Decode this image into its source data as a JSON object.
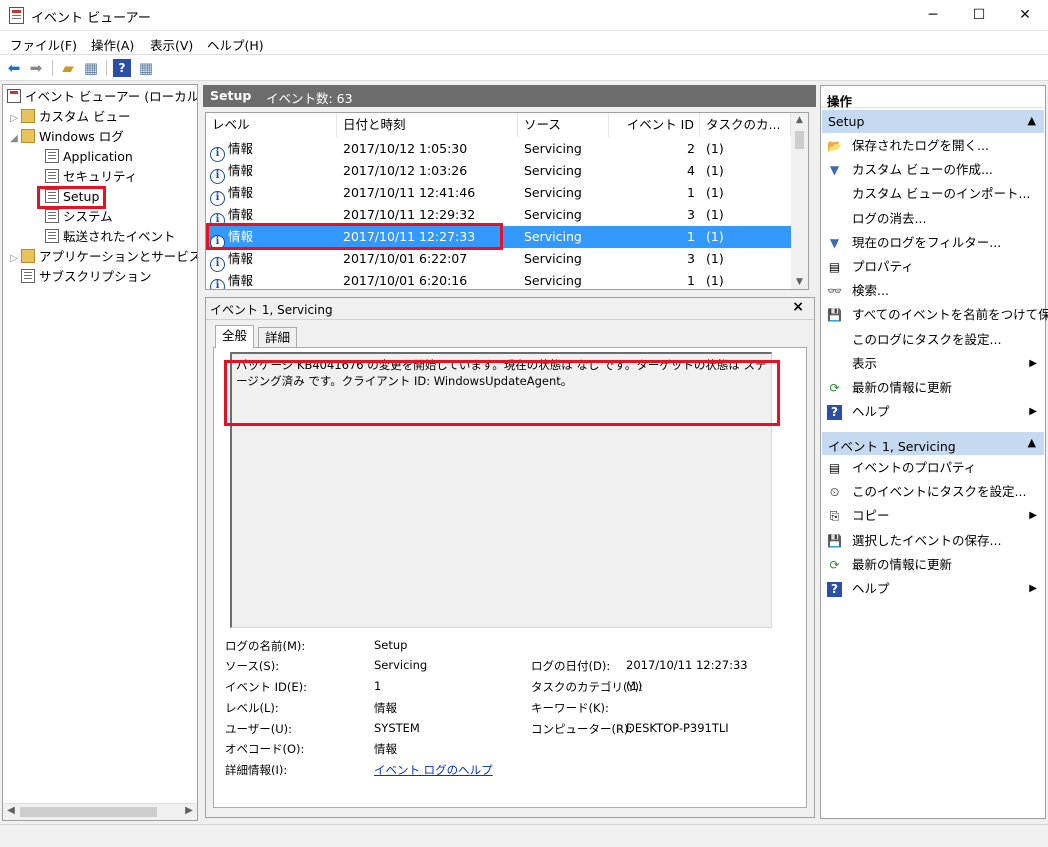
{
  "window": {
    "title": "イベント ビューアー",
    "minimize": "─",
    "maximize": "☐",
    "close": "✕"
  },
  "menu": [
    "ファイル(F)",
    "操作(A)",
    "表示(V)",
    "ヘルプ(H)"
  ],
  "toolbar": {
    "icons": [
      "back-arrow-icon",
      "forward-arrow-icon",
      "folder-up-icon",
      "show-hide-tree-icon",
      "help-icon",
      "show-hide-action-pane-icon"
    ]
  },
  "tree": {
    "root": "イベント ビューアー (ローカル)",
    "custom_views": "カスタム ビュー",
    "windows_logs": "Windows ログ",
    "application": "Application",
    "security": "セキュリティ",
    "setup": "Setup",
    "system": "システム",
    "forwarded": "転送されたイベント",
    "apps_services": "アプリケーションとサービス ログ",
    "subscriptions": "サブスクリプション"
  },
  "center": {
    "log_name": "Setup",
    "event_count": "イベント数: 63"
  },
  "list": {
    "columns": [
      "レベル",
      "日付と時刻",
      "ソース",
      "イベント ID",
      "タスクのカ..."
    ],
    "rows": [
      {
        "level": "情報",
        "datetime": "2017/10/12 1:05:30",
        "source": "Servicing",
        "id": "2",
        "task": "(1)"
      },
      {
        "level": "情報",
        "datetime": "2017/10/12 1:03:26",
        "source": "Servicing",
        "id": "4",
        "task": "(1)"
      },
      {
        "level": "情報",
        "datetime": "2017/10/11 12:41:46",
        "source": "Servicing",
        "id": "1",
        "task": "(1)"
      },
      {
        "level": "情報",
        "datetime": "2017/10/11 12:29:32",
        "source": "Servicing",
        "id": "3",
        "task": "(1)"
      },
      {
        "level": "情報",
        "datetime": "2017/10/11 12:27:33",
        "source": "Servicing",
        "id": "1",
        "task": "(1)"
      },
      {
        "level": "情報",
        "datetime": "2017/10/01 6:22:07",
        "source": "Servicing",
        "id": "3",
        "task": "(1)"
      },
      {
        "level": "情報",
        "datetime": "2017/10/01 6:20:16",
        "source": "Servicing",
        "id": "1",
        "task": "(1)"
      }
    ],
    "selected_row": 4
  },
  "detail": {
    "title": "イベント 1, Servicing",
    "close": "×",
    "tab_general": "全般",
    "tab_detail": "詳細",
    "description": "パッケージ KB4041676 の変更を開始しています。現在の状態は なし です。ターゲットの状態は ステージング済み です。クライアント ID: WindowsUpdateAgent。",
    "labels": {
      "log_name": "ログの名前(M):",
      "source": "ソース(S):",
      "event_id": "イベント ID(E):",
      "level": "レベル(L):",
      "user": "ユーザー(U):",
      "opcode": "オペコード(O):",
      "more_info": "詳細情報(I):",
      "logged": "ログの日付(D):",
      "task_category": "タスクのカテゴリ(Y):",
      "keywords": "キーワード(K):",
      "computer": "コンピューター(R):"
    },
    "values": {
      "log_name": "Setup",
      "source": "Servicing",
      "event_id": "1",
      "level": "情報",
      "user": "SYSTEM",
      "opcode": "情報",
      "more_info": "イベント ログのヘルプ",
      "logged": "2017/10/11 12:27:33",
      "task_category": "(1)",
      "keywords": "",
      "computer": "DESKTOP-P391TLI"
    }
  },
  "actions": {
    "header": "操作",
    "section1": "Setup",
    "items1": [
      {
        "icon": "open-folder-icon",
        "glyph": "📂",
        "label": "保存されたログを開く...",
        "sub": false
      },
      {
        "icon": "filter-create-icon",
        "glyph": "▼",
        "label": "カスタム ビューの作成...",
        "sub": false
      },
      {
        "icon": "",
        "glyph": "",
        "label": "カスタム ビューのインポート...",
        "sub": false
      },
      {
        "icon": "",
        "glyph": "",
        "label": "ログの消去...",
        "sub": false
      },
      {
        "icon": "filter-icon",
        "glyph": "▼",
        "label": "現在のログをフィルター...",
        "sub": false
      },
      {
        "icon": "properties-icon",
        "glyph": "▤",
        "label": "プロパティ",
        "sub": false
      },
      {
        "icon": "binoculars-icon",
        "glyph": "👓",
        "label": "検索...",
        "sub": false
      },
      {
        "icon": "save-icon",
        "glyph": "💾",
        "label": "すべてのイベントを名前をつけて保存...",
        "sub": false
      },
      {
        "icon": "",
        "glyph": "",
        "label": "このログにタスクを設定...",
        "sub": false
      },
      {
        "icon": "",
        "glyph": "",
        "label": "表示",
        "sub": true
      },
      {
        "icon": "refresh-icon",
        "glyph": "⟳",
        "label": "最新の情報に更新",
        "sub": false
      },
      {
        "icon": "help-icon",
        "glyph": "?",
        "label": "ヘルプ",
        "sub": true
      }
    ],
    "section2": "イベント 1, Servicing",
    "items2": [
      {
        "icon": "event-properties-icon",
        "glyph": "▤",
        "label": "イベントのプロパティ",
        "sub": false
      },
      {
        "icon": "task-icon",
        "glyph": "⏲",
        "label": "このイベントにタスクを設定...",
        "sub": false
      },
      {
        "icon": "copy-icon",
        "glyph": "⎘",
        "label": "コピー",
        "sub": true
      },
      {
        "icon": "save-icon",
        "glyph": "💾",
        "label": "選択したイベントの保存...",
        "sub": false
      },
      {
        "icon": "refresh-icon",
        "glyph": "⟳",
        "label": "最新の情報に更新",
        "sub": false
      },
      {
        "icon": "help-icon",
        "glyph": "?",
        "label": "ヘルプ",
        "sub": true
      }
    ]
  }
}
